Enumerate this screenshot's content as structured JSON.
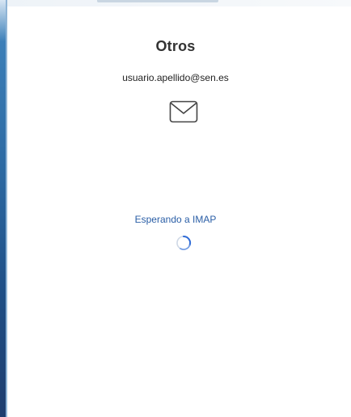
{
  "account": {
    "provider_title": "Otros",
    "email": "usuario.apellido@sen.es"
  },
  "icons": {
    "mail": "envelope-icon",
    "spinner": "loading-spinner-icon"
  },
  "status": {
    "message": "Esperando a IMAP"
  },
  "colors": {
    "title": "#333333",
    "status_text": "#2a5ea6",
    "spinner_arc": "#2f6bd6",
    "spinner_track": "#cfd8e6",
    "window_edge": "#2d6aa3"
  }
}
